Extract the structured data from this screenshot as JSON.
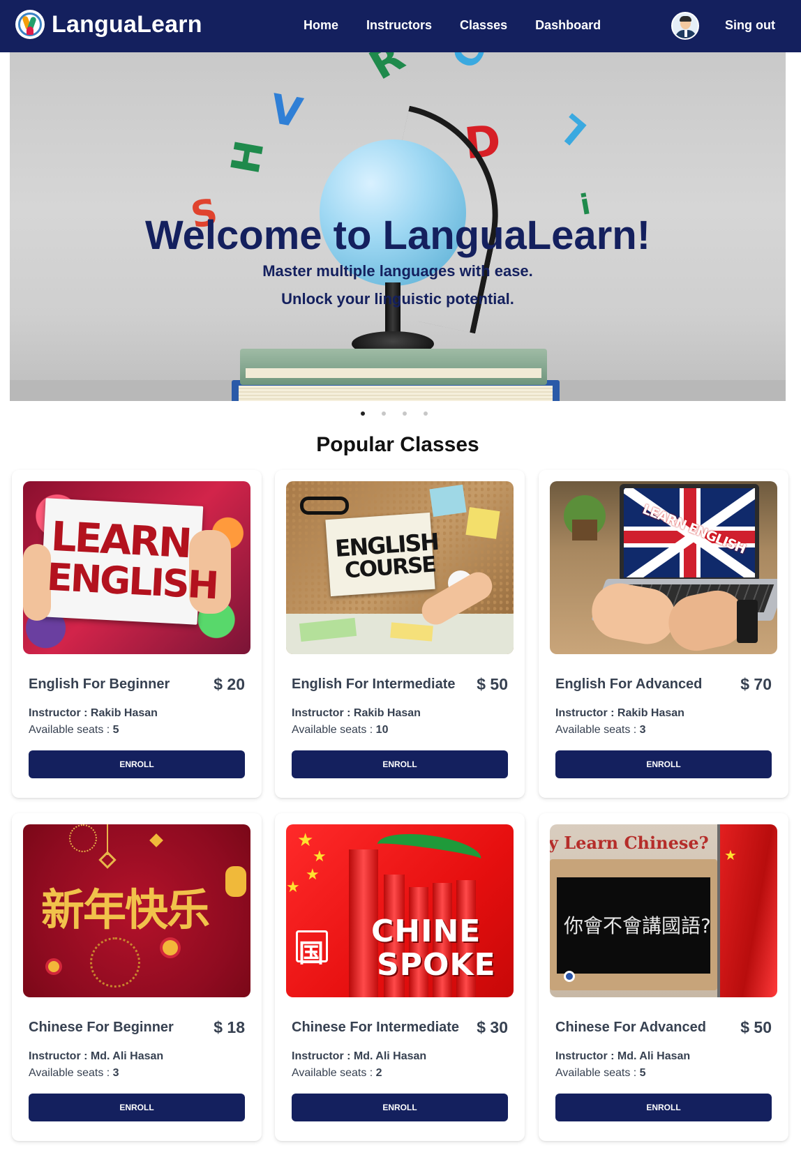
{
  "navbar": {
    "brand": "LanguaLearn",
    "links": [
      "Home",
      "Instructors",
      "Classes",
      "Dashboard"
    ],
    "signout": "Sing out"
  },
  "hero": {
    "title": "Welcome to LanguaLearn!",
    "subtitle1": "Master multiple languages with ease.",
    "subtitle2": "Unlock your linguistic potential.",
    "slide_count": 4,
    "active_slide": 1
  },
  "popular": {
    "title": "Popular Classes",
    "instructor_label": "Instructor : ",
    "seats_label": "Available seats : ",
    "enroll_label": "ENROLL",
    "classes": [
      {
        "name": "English For Beginner",
        "price": "$ 20",
        "instructor": "Rakib Hasan",
        "seats": "5",
        "image_text": [
          "LEARN",
          "ENGLISH"
        ]
      },
      {
        "name": "English For Intermediate",
        "price": "$ 50",
        "instructor": "Rakib Hasan",
        "seats": "10",
        "image_text": [
          "ENGLISH",
          "COURSE"
        ]
      },
      {
        "name": "English For Advanced",
        "price": "$ 70",
        "instructor": "Rakib Hasan",
        "seats": "3",
        "image_text": [
          "LEARN ENGLISH"
        ]
      },
      {
        "name": "Chinese For Beginner",
        "price": "$ 18",
        "instructor": "Md. Ali Hasan",
        "seats": "3",
        "image_text": [
          "新年快乐"
        ]
      },
      {
        "name": "Chinese For Intermediate",
        "price": "$ 30",
        "instructor": "Md. Ali Hasan",
        "seats": "2",
        "image_text": [
          "CHINE",
          "SPOKE",
          "国"
        ]
      },
      {
        "name": "Chinese For Advanced",
        "price": "$ 50",
        "instructor": "Md. Ali Hasan",
        "seats": "5",
        "image_text": [
          "y Learn Chinese?",
          "你會不會講國語?"
        ]
      }
    ]
  },
  "colors": {
    "primary": "#14205e",
    "text": "#374151"
  }
}
